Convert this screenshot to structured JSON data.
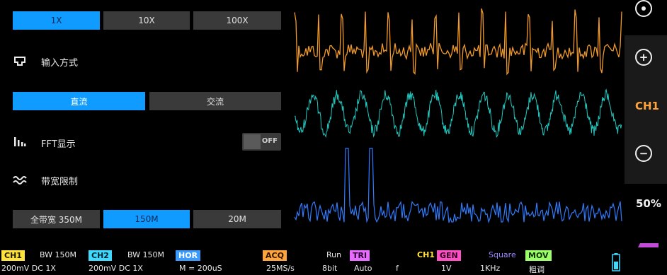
{
  "probe": {
    "options": [
      "1X",
      "10X",
      "100X"
    ],
    "selected": "1X"
  },
  "input_mode": {
    "label": "输入方式",
    "options": [
      "直流",
      "交流"
    ],
    "selected": "直流"
  },
  "fft": {
    "label": "FFT显示",
    "toggle_text": "OFF",
    "state": "off"
  },
  "bandwidth": {
    "label": "带宽限制",
    "options": [
      "全带宽 350M",
      "150M",
      "20M"
    ],
    "selected": "150M"
  },
  "sidebar": {
    "top_icon": "target-icon",
    "zoom_in": "+",
    "channel": "CH1",
    "zoom_out": "−",
    "percent": "50%",
    "trigger_tab": "T"
  },
  "status_bar": {
    "ch1_tag": "CH1",
    "ch1_bw": "BW 150M",
    "ch2_tag": "CH2",
    "ch2_bw": "BW 150M",
    "hor_tag": "HOR",
    "acq_tag": "ACQ",
    "run": "Run",
    "tri_tag": "TRI",
    "ch1_gen": "CH1",
    "gen_tag": "GEN",
    "square": "Square",
    "mov_tag": "MOV",
    "line2_a": "200mV  DC   1X",
    "line2_b": "200mV  DC   1X",
    "line2_m": "M = 200uS",
    "line2_rate": "25MS/s",
    "line2_bits": "8bit",
    "line2_auto": "Auto",
    "line2_f": "f",
    "line2_v": "1V",
    "line2_khz": "1KHz",
    "line2_adj": "粗调"
  },
  "colors": {
    "accent_blue": "#0f9bff",
    "ch1_orange": "#f39a24",
    "ch2_teal": "#21c8c0",
    "fft_blue": "#2f7cff",
    "ch1_tag": "#ffe23a",
    "ch2_tag": "#3fd8ff",
    "hor_tag": "#3a9bff",
    "acq_tag": "#ffa43a",
    "tri_tag": "#e86cff",
    "gen_tag": "#ff4fc4",
    "mov_tag": "#9cff6a",
    "trigger": "#c04bd6"
  }
}
